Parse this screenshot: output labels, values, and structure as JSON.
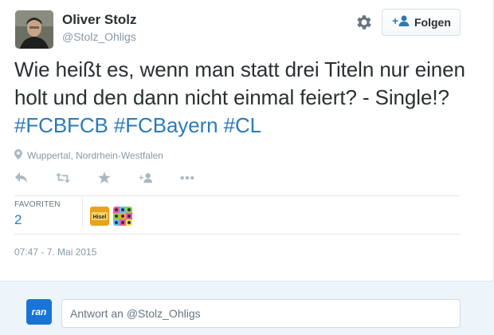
{
  "user": {
    "name": "Oliver Stolz",
    "handle": "@Stolz_Ohligs"
  },
  "follow_button": {
    "label": "Folgen"
  },
  "tweet": {
    "text_plain": "Wie heißt es, wenn man statt drei Titeln nur einen holt und den dann nicht einmal feiert? - Single!? ",
    "hashtags": [
      "#FCBFCB",
      "#FCBayern",
      "#CL"
    ]
  },
  "location": "Wuppertal, Nordrhein-Westfalen",
  "actions": [
    "reply-icon",
    "retweet-icon",
    "favorite-icon",
    "follow-icon",
    "more-icon"
  ],
  "stats": {
    "favorites_label": "FAVORITEN",
    "favorites_count": "2"
  },
  "favoriters": [
    {
      "icon": "hisel-avatar",
      "text": "Hisel"
    },
    {
      "icon": "pattern-avatar",
      "text": ""
    }
  ],
  "timestamp": "07:47 - 7. Mai 2015",
  "reply": {
    "avatar_text": "ran",
    "placeholder": "Antwort an @Stolz_Ohligs"
  },
  "colors": {
    "link": "#2b7bb9",
    "muted": "#8899a6",
    "reply_bg": "#eef5fa"
  }
}
